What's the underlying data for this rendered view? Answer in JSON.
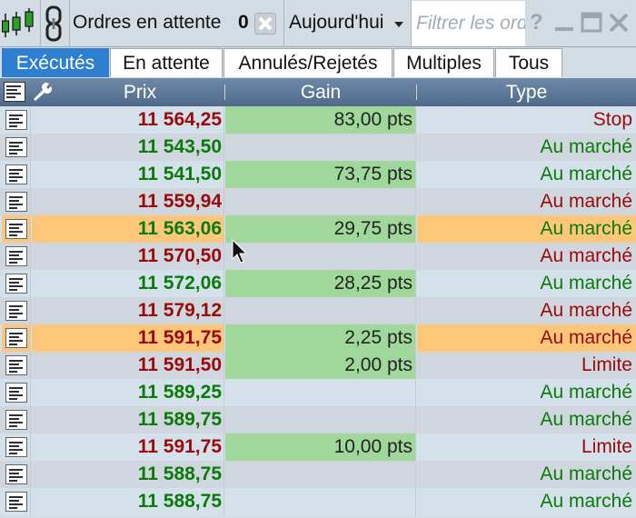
{
  "toolbar": {
    "orders_label": "Ordres en attente",
    "orders_count": "0",
    "date_value": "Aujourd'hui",
    "filter_placeholder": "Filtrer les ordres",
    "help_label": "?"
  },
  "tabs": [
    {
      "label": "Exécutés",
      "active": true
    },
    {
      "label": "En attente",
      "active": false
    },
    {
      "label": "Annulés/Rejetés",
      "active": false
    },
    {
      "label": "Multiples",
      "active": false
    },
    {
      "label": "Tous",
      "active": false
    }
  ],
  "columns": {
    "prix": "Prix",
    "gain": "Gain",
    "type": "Type"
  },
  "colors": {
    "up": "#0a7a0a",
    "down": "#9a0a0a",
    "gain_bg": "#a0d79b",
    "highlight": "#fdc77a",
    "tab_active": "#2f7fd0"
  },
  "rows": [
    {
      "prix": "11 564,25",
      "dir": "down",
      "gain": "83,00 pts",
      "type": "Stop",
      "type_dir": "down",
      "highlight": false
    },
    {
      "prix": "11 543,50",
      "dir": "up",
      "gain": "",
      "type": "Au marché",
      "type_dir": "up",
      "highlight": false
    },
    {
      "prix": "11 541,50",
      "dir": "up",
      "gain": "73,75 pts",
      "type": "Au marché",
      "type_dir": "up",
      "highlight": false
    },
    {
      "prix": "11 559,94",
      "dir": "down",
      "gain": "",
      "type": "Au marché",
      "type_dir": "down",
      "highlight": false
    },
    {
      "prix": "11 563,06",
      "dir": "up",
      "gain": "29,75 pts",
      "type": "Au marché",
      "type_dir": "up",
      "highlight": true
    },
    {
      "prix": "11 570,50",
      "dir": "down",
      "gain": "",
      "type": "Au marché",
      "type_dir": "down",
      "highlight": false
    },
    {
      "prix": "11 572,06",
      "dir": "up",
      "gain": "28,25 pts",
      "type": "Au marché",
      "type_dir": "up",
      "highlight": false
    },
    {
      "prix": "11 579,12",
      "dir": "down",
      "gain": "",
      "type": "Au marché",
      "type_dir": "down",
      "highlight": false
    },
    {
      "prix": "11 591,75",
      "dir": "down",
      "gain": "2,25 pts",
      "type": "Au marché",
      "type_dir": "down",
      "highlight": true
    },
    {
      "prix": "11 591,50",
      "dir": "down",
      "gain": "2,00 pts",
      "type": "Limite",
      "type_dir": "down",
      "highlight": false
    },
    {
      "prix": "11 589,25",
      "dir": "up",
      "gain": "",
      "type": "Au marché",
      "type_dir": "up",
      "highlight": false
    },
    {
      "prix": "11 589,75",
      "dir": "up",
      "gain": "",
      "type": "Au marché",
      "type_dir": "up",
      "highlight": false
    },
    {
      "prix": "11 591,75",
      "dir": "down",
      "gain": "10,00 pts",
      "type": "Limite",
      "type_dir": "down",
      "highlight": false
    },
    {
      "prix": "11 588,75",
      "dir": "up",
      "gain": "",
      "type": "Au marché",
      "type_dir": "up",
      "highlight": false
    },
    {
      "prix": "11 588,75",
      "dir": "up",
      "gain": "",
      "type": "Au marché",
      "type_dir": "up",
      "highlight": false
    }
  ]
}
